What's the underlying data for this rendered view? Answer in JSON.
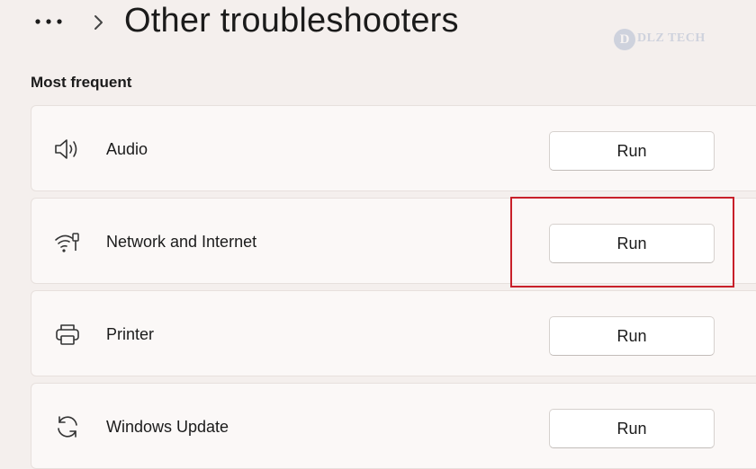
{
  "header": {
    "title": "Other troubleshooters",
    "more_icon": "more-horizontal-icon",
    "separator_icon": "chevron-right-icon"
  },
  "watermark": {
    "text": "DLZ TECH",
    "logo_letter": "D"
  },
  "section": {
    "label": "Most frequent"
  },
  "troubleshooters": [
    {
      "label": "Audio",
      "icon": "speaker-icon",
      "button": "Run"
    },
    {
      "label": "Network and Internet",
      "icon": "network-icon",
      "button": "Run"
    },
    {
      "label": "Printer",
      "icon": "printer-icon",
      "button": "Run"
    },
    {
      "label": "Windows Update",
      "icon": "refresh-icon",
      "button": "Run"
    }
  ],
  "colors": {
    "background": "#f4efed",
    "card": "#fbf8f7",
    "highlight": "#c8202a"
  }
}
